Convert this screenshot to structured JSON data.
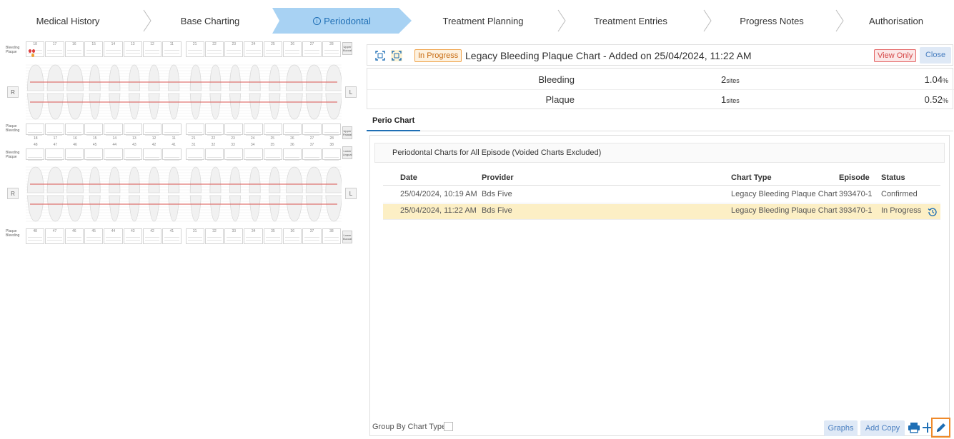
{
  "steps": [
    {
      "label": "Medical History",
      "active": false
    },
    {
      "label": "Base Charting",
      "active": false
    },
    {
      "label": "Periodontal",
      "active": true
    },
    {
      "label": "Treatment Planning",
      "active": false
    },
    {
      "label": "Treatment Entries",
      "active": false
    },
    {
      "label": "Progress Notes",
      "active": false
    },
    {
      "label": "Authorisation",
      "active": false
    }
  ],
  "dental_chart": {
    "upper_numbers": [
      "18",
      "17",
      "16",
      "15",
      "14",
      "13",
      "12",
      "11",
      "21",
      "22",
      "23",
      "24",
      "25",
      "26",
      "27",
      "28"
    ],
    "lower_numbers": [
      "48",
      "47",
      "46",
      "45",
      "44",
      "43",
      "42",
      "41",
      "31",
      "32",
      "33",
      "34",
      "35",
      "36",
      "37",
      "38"
    ],
    "labels": {
      "bleeding": "Bleeding",
      "plaque": "Plaque",
      "right": "R",
      "left": "L",
      "upper_buccal": "Upper Buccal",
      "upper_lingual": "Upper Palatal",
      "lower_lingual": "Lower Lingual",
      "lower_buccal": "Lower Buccal"
    },
    "marker_colors": {
      "bleeding": "#e03b3b",
      "plaque": "#f0a030",
      "gumline": "#d9534f"
    }
  },
  "header": {
    "status": "In Progress",
    "title": "Legacy Bleeding Plaque Chart - Added on 25/04/2024, 11:22 AM",
    "view_only": "View Only",
    "close": "Close"
  },
  "summary": [
    {
      "label": "Bleeding",
      "sites": "2",
      "sites_unit": "sites",
      "percent": "1.04",
      "percent_unit": "%"
    },
    {
      "label": "Plaque",
      "sites": "1",
      "sites_unit": "sites",
      "percent": "0.52",
      "percent_unit": "%"
    }
  ],
  "tabs": {
    "perio_chart": "Perio Chart"
  },
  "list": {
    "heading": "Periodontal Charts for All Episode (Voided Charts Excluded)",
    "columns": {
      "date": "Date",
      "provider": "Provider",
      "chart_type": "Chart Type",
      "episode": "Episode",
      "status": "Status"
    },
    "rows": [
      {
        "date": "25/04/2024, 10:19 AM",
        "provider": "Bds Five",
        "chart_type": "Legacy Bleeding Plaque Chart",
        "episode": "393470-1",
        "status": "Confirmed"
      },
      {
        "date": "25/04/2024, 11:22 AM",
        "provider": "Bds Five",
        "chart_type": "Legacy Bleeding Plaque Chart",
        "episode": "393470-1",
        "status": "In Progress"
      }
    ]
  },
  "footer": {
    "group_by": "Group By Chart Type",
    "graphs": "Graphs",
    "add_copy": "Add Copy"
  },
  "colors": {
    "accent": "#1f6fb5",
    "active_step": "#a8d2f3",
    "selected_row": "#fcefc5",
    "highlight": "#ef8a2a"
  }
}
